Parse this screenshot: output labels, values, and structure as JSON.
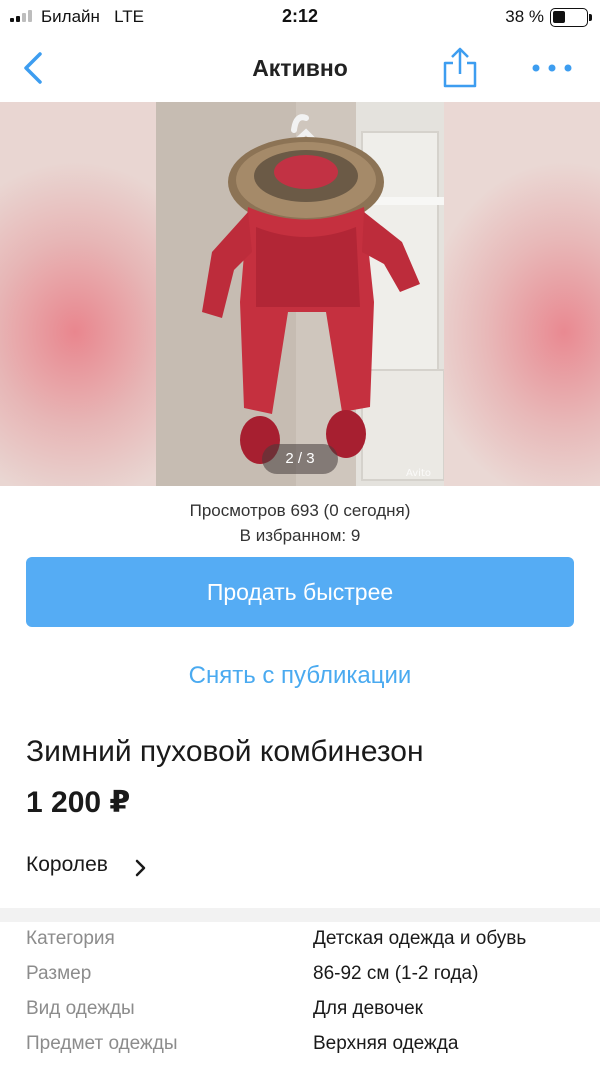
{
  "status_bar": {
    "carrier": "Билайн",
    "network": "LTE",
    "time": "2:12",
    "battery_percent": "38 %",
    "battery_level": 0.38
  },
  "nav": {
    "title": "Активно",
    "back_icon": "chevron-left-icon",
    "share_icon": "share-icon",
    "more_icon": "more-dots-icon"
  },
  "gallery": {
    "counter": "2 / 3",
    "watermark": "Avito"
  },
  "stats": {
    "views": "Просмотров 693 (0 сегодня)",
    "favorites": "В избранном: 9"
  },
  "actions": {
    "sell_faster": "Продать быстрее",
    "unpublish": "Снять с публикации"
  },
  "listing": {
    "title": "Зимний пуховой комбинезон",
    "price": "1 200 ₽",
    "location": "Королев"
  },
  "params": [
    {
      "label": "Категория",
      "value": "Детская одежда и обувь"
    },
    {
      "label": "Размер",
      "value": "86-92 см (1-2 года)"
    },
    {
      "label": "Вид одежды",
      "value": "Для девочек"
    },
    {
      "label": "Предмет одежды",
      "value": "Верхняя одежда"
    }
  ],
  "colors": {
    "accent": "#55acf4",
    "link": "#4aaaf0"
  }
}
